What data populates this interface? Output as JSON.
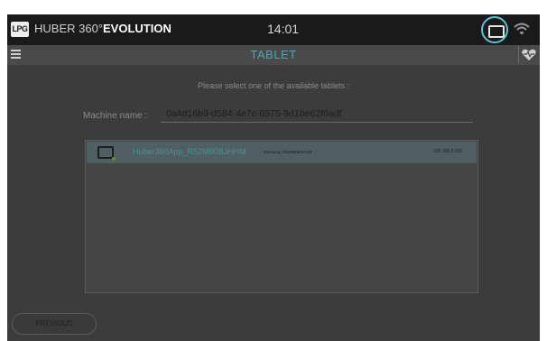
{
  "app": {
    "logo_text": "LPG",
    "brand_prefix": "HUBER 360°",
    "brand_suffix": "EVOLUTION",
    "clock": "14:01"
  },
  "header": {
    "title": "TABLET"
  },
  "main": {
    "prompt": "Please select one of the available tablets :",
    "machine_label": "Machine name :",
    "machine_value": "0a4d16b9-d584-4e7c-8575-9d1be62f0adf"
  },
  "tablets": [
    {
      "name": "Huber360App_R52M90BJHHM",
      "model": "samsung_R52M90BJHHM",
      "ip": "192.168.2.192",
      "selected": true
    }
  ],
  "footer": {
    "previous_label": "PREVIOUS"
  },
  "colors": {
    "accent": "#59c3d4",
    "topbar": "#1a1a1a",
    "titlebar": "#4a4a4a",
    "background": "#3c3c3c",
    "selected_row": "#4f5f62"
  },
  "icons": [
    "menu-icon",
    "tablet-icon",
    "wifi-icon",
    "heart-icon"
  ]
}
